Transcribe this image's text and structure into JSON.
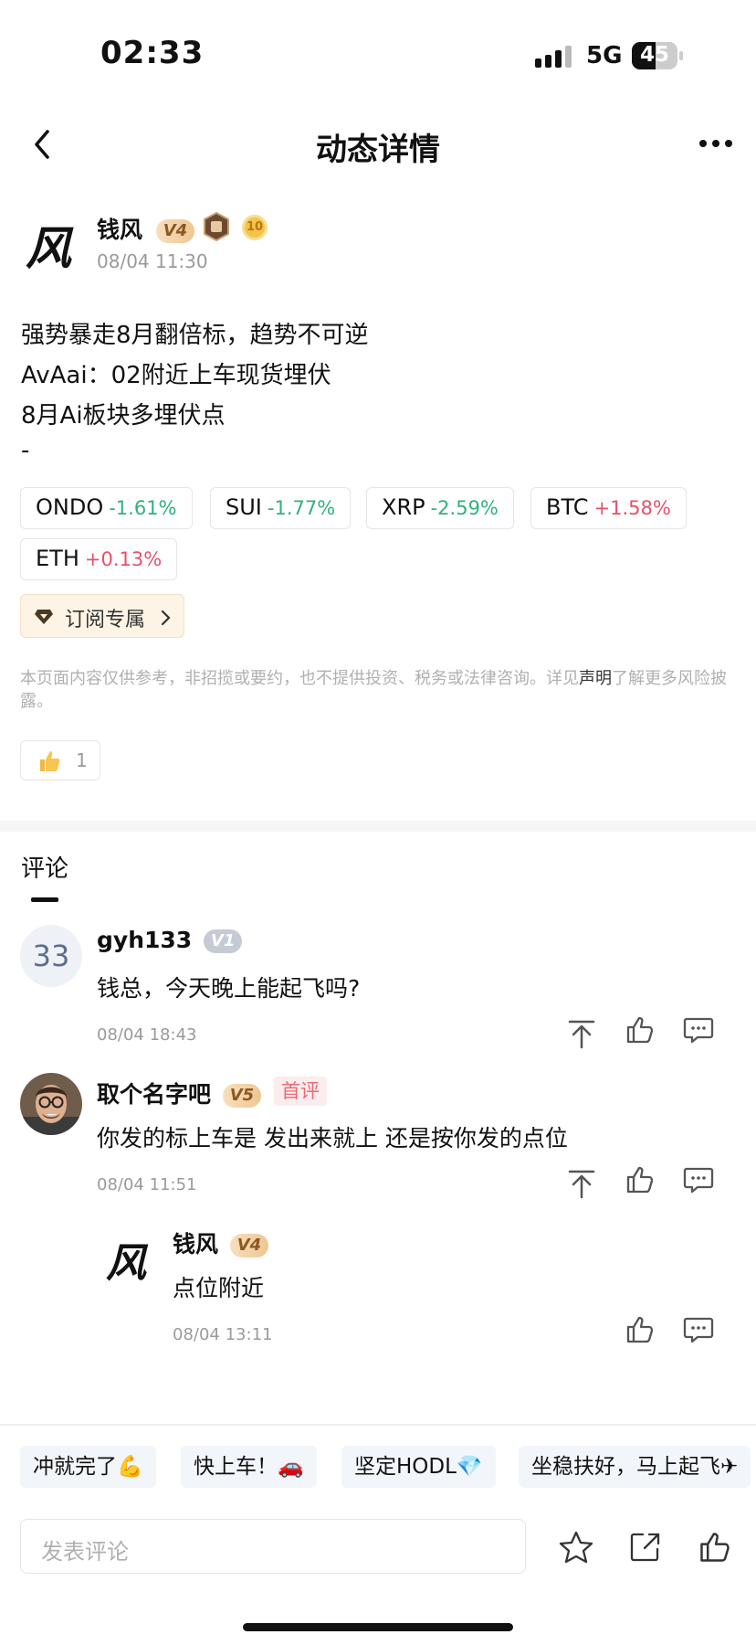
{
  "status_bar": {
    "time": "02:33",
    "network": "5G",
    "battery": "45"
  },
  "nav": {
    "title": "动态详情"
  },
  "author": {
    "name": "钱风",
    "level": "V4",
    "level_badge": "10",
    "time": "08/04 11:30",
    "logo_glyph": "风"
  },
  "post": {
    "lines": [
      "强势暴走8月翻倍标，趋势不可逆",
      "AvAai：02附近上车现货埋伏",
      "8月Ai板块多埋伏点",
      "-"
    ]
  },
  "tickers": [
    {
      "symbol": "ONDO",
      "change": "-1.61%",
      "dir": "neg"
    },
    {
      "symbol": "SUI",
      "change": "-1.77%",
      "dir": "neg"
    },
    {
      "symbol": "XRP",
      "change": "-2.59%",
      "dir": "neg"
    },
    {
      "symbol": "BTC",
      "change": "+1.58%",
      "dir": "pos"
    },
    {
      "symbol": "ETH",
      "change": "+0.13%",
      "dir": "pos"
    }
  ],
  "subscribe": {
    "label": "订阅专属"
  },
  "disclaimer": {
    "before": "本页面内容仅供参考，非招揽或要约，也不提供投资、税务或法律咨询。详见",
    "link": "声明",
    "after": "了解更多风险披露。"
  },
  "likes": {
    "count": "1"
  },
  "comments_section": {
    "title": "评论"
  },
  "comments": [
    {
      "avatar_text": "33",
      "name": "gyh133",
      "level": "V1",
      "text": "钱总，今天晚上能起飞吗?",
      "time": "08/04 18:43"
    },
    {
      "name": "取个名字吧",
      "level": "V5",
      "tag": "首评",
      "text": "你发的标上车是 发出来就上 还是按你发的点位",
      "time": "08/04 11:51"
    },
    {
      "name": "钱风",
      "level": "V4",
      "text": "点位附近",
      "time": "08/04 13:11",
      "logo_glyph": "风"
    }
  ],
  "quick_replies": [
    "冲就完了💪",
    "快上车！🚗",
    "坚定HODL💎",
    "坐稳扶好，马上起飞✈"
  ],
  "composer": {
    "placeholder": "发表评论"
  },
  "colors": {
    "negative": "#2fb27a",
    "positive": "#e8506a",
    "level_gold": "#efc692"
  }
}
